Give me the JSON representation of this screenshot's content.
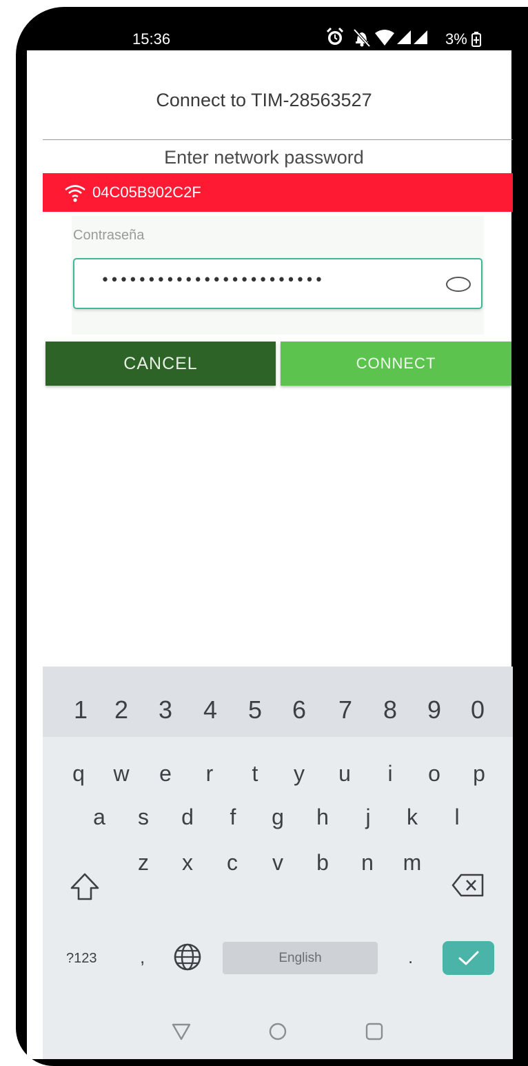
{
  "status_bar": {
    "time": "15:36",
    "battery": "3%",
    "icons": [
      "alarm-icon",
      "bell-off-icon",
      "wifi-icon",
      "signal-icon",
      "signal-icon",
      "battery-charging-icon"
    ]
  },
  "dialog": {
    "title": "Connect to TIM-28563527",
    "subtitle": "Enter network password",
    "network": {
      "icon": "wifi-icon",
      "name": "04C05B902C2F"
    },
    "password": {
      "label": "Contraseña",
      "value": "••••••••••••••••••••••••",
      "toggle_icon": "eye-icon"
    },
    "buttons": {
      "cancel": "CANCEL",
      "connect": "CONNECT"
    }
  },
  "keyboard": {
    "numbers": [
      "1",
      "2",
      "3",
      "4",
      "5",
      "6",
      "7",
      "8",
      "9",
      "0"
    ],
    "row1": [
      "q",
      "w",
      "e",
      "r",
      "t",
      "y",
      "u",
      "i",
      "o",
      "p"
    ],
    "row2": [
      "a",
      "s",
      "d",
      "f",
      "g",
      "h",
      "j",
      "k",
      "l"
    ],
    "row3": [
      "z",
      "x",
      "c",
      "v",
      "b",
      "n",
      "m"
    ],
    "symbols_key": "?123",
    "comma_key": ",",
    "space_label": "English",
    "period_key": ".",
    "enter_icon": "check-icon",
    "shift_icon": "shift-icon",
    "backspace_icon": "backspace-icon",
    "globe_icon": "globe-icon"
  },
  "colors": {
    "network_bar": "#ff1a33",
    "cancel_button": "#2d6327",
    "connect_button": "#5cc34f",
    "input_border": "#3fb89a",
    "enter_key": "#4bb4a8"
  }
}
